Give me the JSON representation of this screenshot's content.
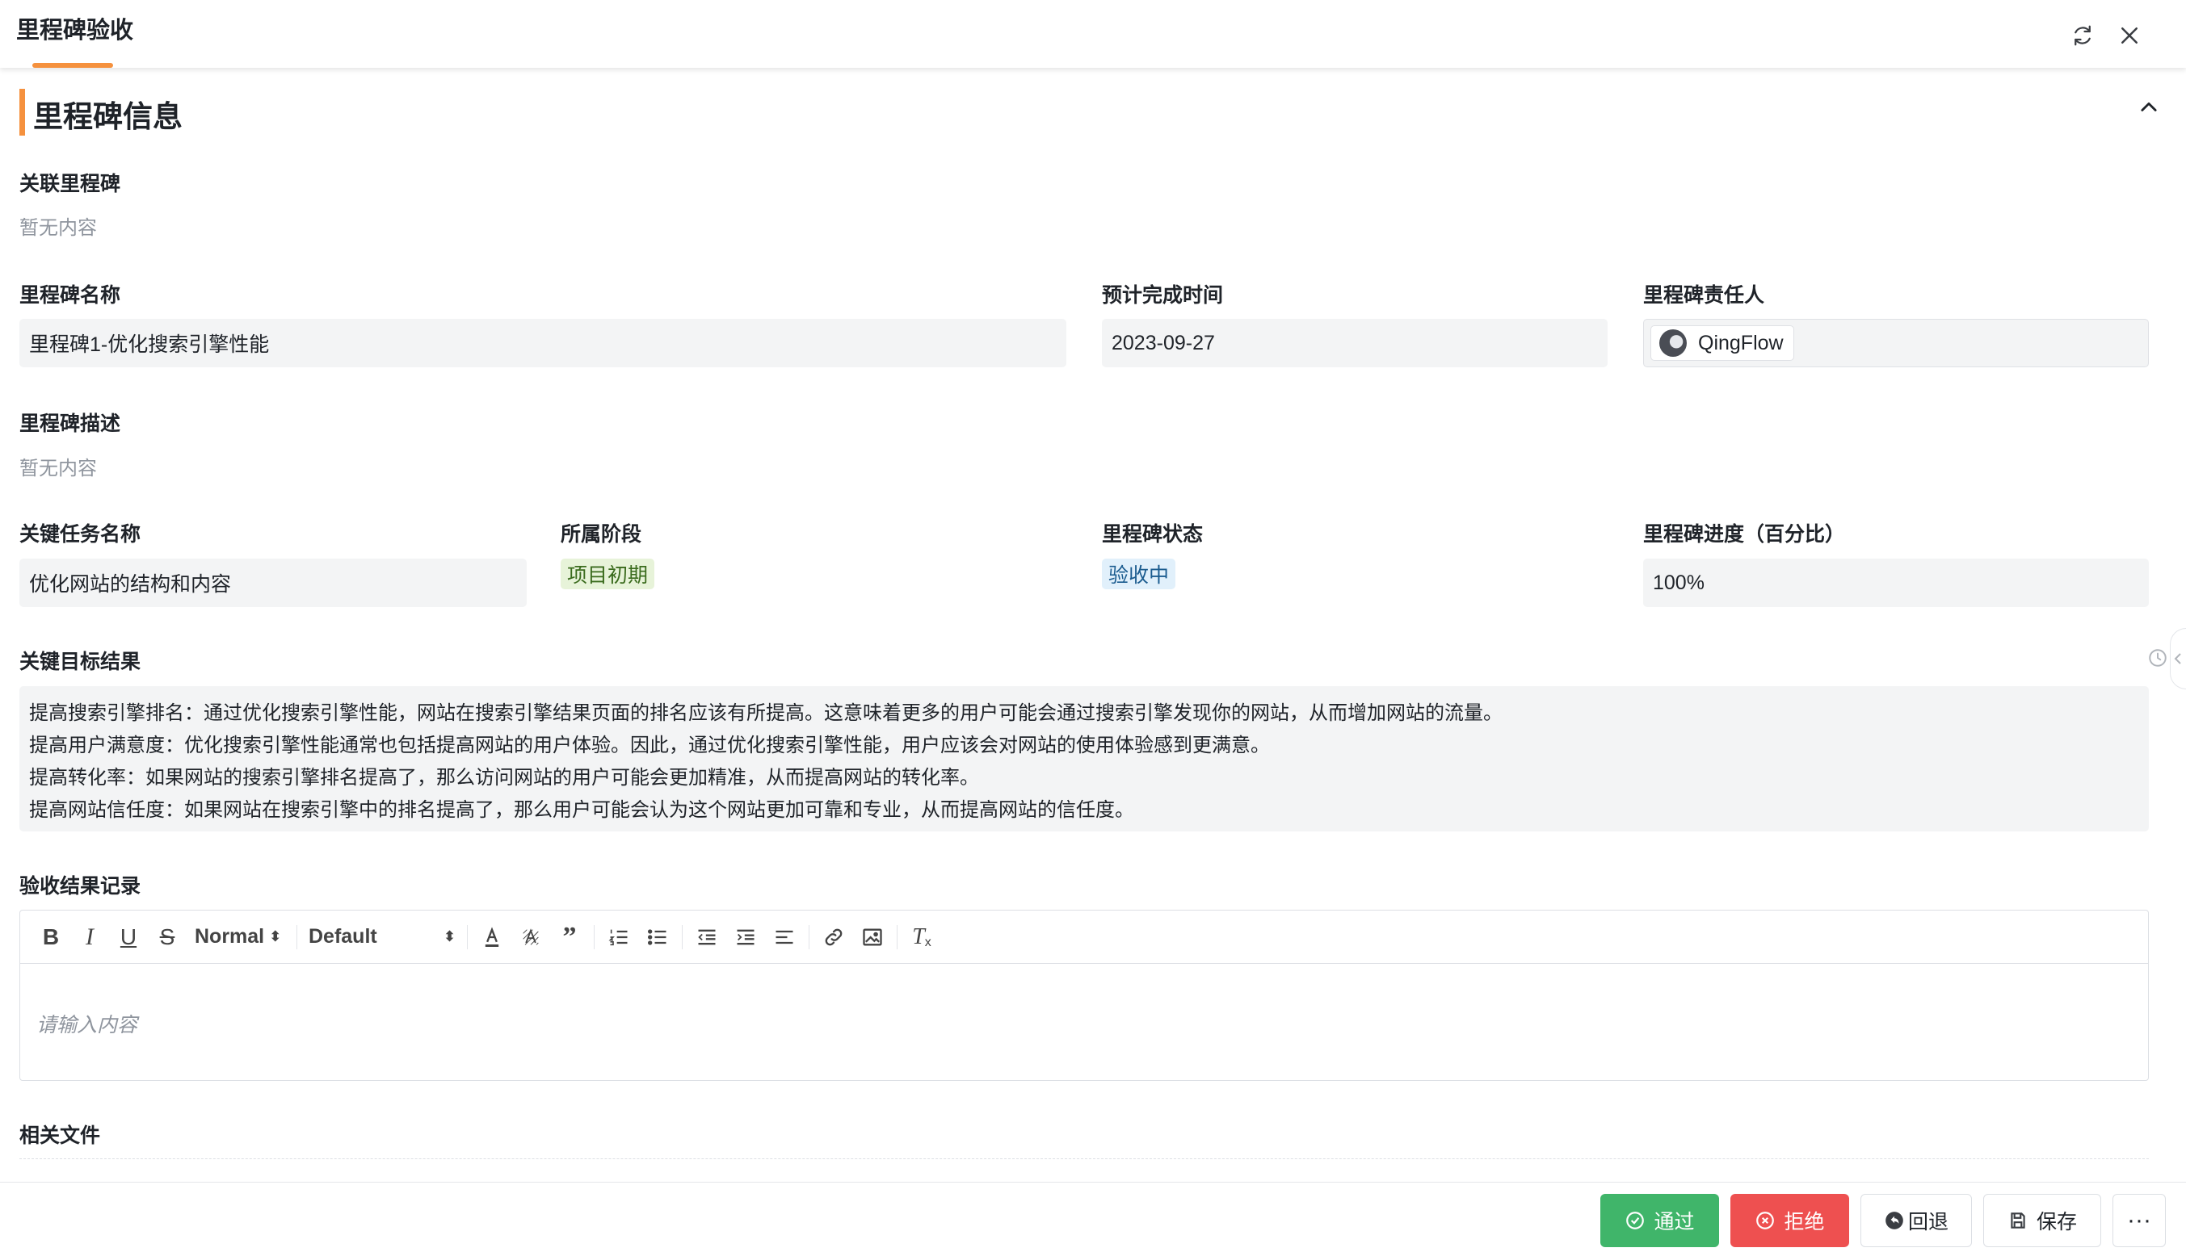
{
  "header": {
    "title": "里程碑验收"
  },
  "section": {
    "title": "里程碑信息"
  },
  "related_milestone": {
    "label": "关联里程碑",
    "empty": "暂无内容"
  },
  "milestone_name": {
    "label": "里程碑名称",
    "value": "里程碑1-优化搜索引擎性能"
  },
  "due_date": {
    "label": "预计完成时间",
    "value": "2023-09-27"
  },
  "owner": {
    "label": "里程碑责任人",
    "name": "QingFlow"
  },
  "description": {
    "label": "里程碑描述",
    "empty": "暂无内容"
  },
  "key_task": {
    "label": "关键任务名称",
    "value": "优化网站的结构和内容"
  },
  "stage": {
    "label": "所属阶段",
    "value": "项目初期",
    "color": "#e7f3d9"
  },
  "status": {
    "label": "里程碑状态",
    "value": "验收中",
    "color": "#e1f0fb"
  },
  "progress": {
    "label": "里程碑进度（百分比）",
    "value": "100%"
  },
  "key_results": {
    "label": "关键目标结果",
    "lines": [
      "提高搜索引擎排名：通过优化搜索引擎性能，网站在搜索引擎结果页面的排名应该有所提高。这意味着更多的用户可能会通过搜索引擎发现你的网站，从而增加网站的流量。",
      "提高用户满意度：优化搜索引擎性能通常也包括提高网站的用户体验。因此，通过优化搜索引擎性能，用户应该会对网站的使用体验感到更满意。",
      "提高转化率：如果网站的搜索引擎排名提高了，那么访问网站的用户可能会更加精准，从而提高网站的转化率。",
      "提高网站信任度：如果网站在搜索引擎中的排名提高了，那么用户可能会认为这个网站更加可靠和专业，从而提高网站的信任度。"
    ]
  },
  "acceptance_record": {
    "label": "验收结果记录",
    "toolbar": {
      "size": "Normal",
      "font": "Default"
    },
    "placeholder": "请输入内容"
  },
  "files": {
    "label": "相关文件"
  },
  "footer": {
    "pass": "通过",
    "reject": "拒绝",
    "back": "回退",
    "save": "保存",
    "more": "···"
  },
  "colors": {
    "accent": "#f5913e",
    "pass": "#40b56a",
    "reject": "#ee5050"
  }
}
